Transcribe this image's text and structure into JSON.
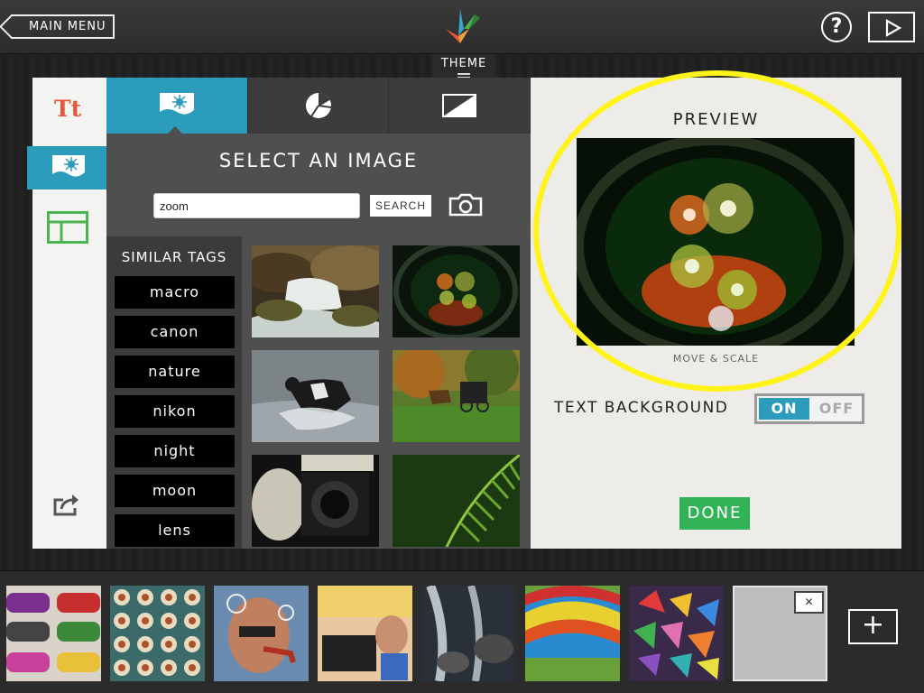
{
  "topbar": {
    "main_menu_label": "MAIN MENU",
    "help_label": "?",
    "theme_label": "THEME"
  },
  "left_rail": {
    "text_icon": "Tt",
    "items": [
      "text-tool",
      "image-tool",
      "layout-tool",
      "share-tool"
    ]
  },
  "image_panel": {
    "tabs": [
      "image-tab",
      "pie-tab",
      "contrast-tab"
    ],
    "title": "SELECT AN IMAGE",
    "search": {
      "value": "zoom",
      "button": "SEARCH"
    },
    "tags": {
      "title": "SIMILAR TAGS",
      "items": [
        "macro",
        "canon",
        "nature",
        "nikon",
        "night",
        "moon",
        "lens"
      ]
    },
    "thumbs": [
      "waterfall",
      "lens-bokeh",
      "dog-splash",
      "horse-buggy",
      "camera-portrait",
      "fern-leaf"
    ]
  },
  "preview": {
    "title": "PREVIEW",
    "hint": "MOVE & SCALE",
    "text_background_label": "TEXT BACKGROUND",
    "toggle_on": "ON",
    "toggle_off": "OFF",
    "done": "DONE",
    "highlight_color": "#fff31a"
  },
  "filmstrip": {
    "slides": [
      "sunglasses",
      "tiles",
      "bubble-pipe",
      "typewriter-boy",
      "waterfall-rocks",
      "balloon",
      "paper-cranes"
    ],
    "close_label": "✕",
    "add_label": "+"
  },
  "colors": {
    "accent": "#2b9cbc",
    "done": "#32b356",
    "text_icon": "#e4573b"
  }
}
